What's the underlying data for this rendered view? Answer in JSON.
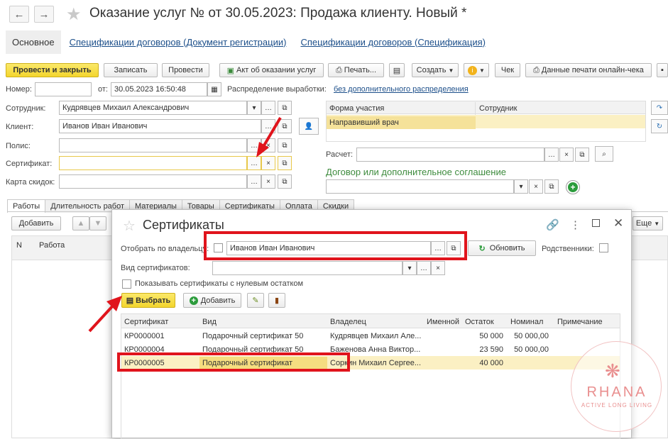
{
  "window": {
    "title": "Оказание услуг №  от 30.05.2023: Продажа клиенту.  Новый *",
    "back_icon": "←",
    "forward_icon": "→"
  },
  "tabs": {
    "main": "Основное",
    "spec_reg": "Спецификации договоров (Документ регистрации)",
    "spec": "Спецификации договоров (Спецификация)"
  },
  "toolbar": {
    "post_close": "Провести и закрыть",
    "save": "Записать",
    "post": "Провести",
    "act": "Акт об оказании услуг",
    "print": "Печать...",
    "create": "Создать",
    "check": "Чек",
    "online_check": "Данные печати онлайн-чека"
  },
  "form": {
    "number_label": "Номер:",
    "number_value": "",
    "from_label": "от:",
    "date_value": "30.05.2023 16:50:48",
    "distribution_label": "Распределение выработки:",
    "distribution_link": "без дополнительного распределения",
    "employee_label": "Сотрудник:",
    "employee_value": "Кудрявцев Михаил Александрович",
    "client_label": "Клиент:",
    "client_value": "Иванов Иван Иванович",
    "policy_label": "Полис:",
    "certificate_label": "Сертификат:",
    "discount_label": "Карта скидок:",
    "calc_label": "Расчет:",
    "contract_heading": "Договор или дополнительное соглашение"
  },
  "participation": {
    "headers": [
      "Форма участия",
      "Сотрудник"
    ],
    "rows": [
      [
        "Направивший врач",
        ""
      ]
    ]
  },
  "bottom_tabs": [
    "Работы",
    "Длительность работ",
    "Материалы",
    "Товары",
    "Сертификаты",
    "Оплата",
    "Скидки"
  ],
  "works": {
    "add": "Добавить",
    "more": "Еще",
    "headers": [
      "N",
      "Работа"
    ]
  },
  "dialog": {
    "title": "Сертификаты",
    "owner_label": "Отобрать по владельцу:",
    "owner_value": "Иванов Иван Иванович",
    "refresh": "Обновить",
    "relatives_label": "Родственники:",
    "type_label": "Вид сертификатов:",
    "zero_label": "Показывать сертификаты с нулевым остатком",
    "select": "Выбрать",
    "add": "Добавить",
    "headers": [
      "Сертификат",
      "Вид",
      "Владелец",
      "Именной",
      "Остаток",
      "Номинал",
      "Примечание"
    ],
    "rows": [
      [
        "КР0000001",
        "Подарочный сертификат 50",
        "Кудрявцев Михаил Але...",
        "",
        "50 000",
        "50 000,00",
        ""
      ],
      [
        "КР0000004",
        "Подарочный сертификат 50",
        "Баженова Анна Виктор...",
        "",
        "23 590",
        "50 000,00",
        ""
      ],
      [
        "КР0000005",
        "Подарочный сертификат",
        "Соркин Михаил Сергее...",
        "",
        "40 000",
        "",
        ""
      ]
    ]
  },
  "watermark": {
    "brand": "RHANA",
    "tagline": "ACTIVE LONG LIVING"
  }
}
